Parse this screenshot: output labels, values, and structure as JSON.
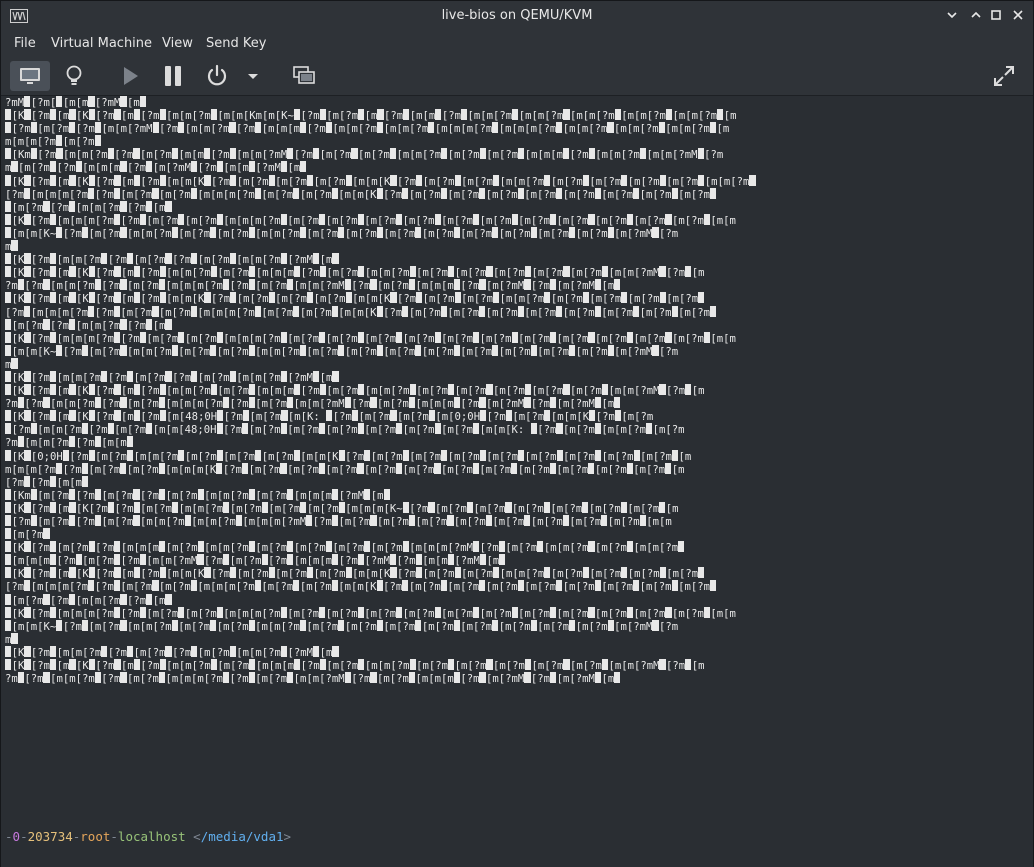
{
  "window": {
    "title": "live-bios on QEMU/KVM",
    "controls": [
      "minimize",
      "maximize",
      "restore",
      "close"
    ]
  },
  "menu": [
    "File",
    "Virtual Machine",
    "View",
    "Send Key"
  ],
  "toolbar": {
    "buttons": [
      {
        "name": "console-view",
        "icon": "monitor-icon"
      },
      {
        "name": "details-view",
        "icon": "lightbulb-icon"
      },
      {
        "name": "run",
        "icon": "play-icon"
      },
      {
        "name": "pause",
        "icon": "pause-icon"
      },
      {
        "name": "shutdown",
        "icon": "power-icon"
      },
      {
        "name": "shutdown-menu",
        "icon": "chevron-down-icon"
      },
      {
        "name": "snapshots",
        "icon": "screens-icon"
      },
      {
        "name": "fullscreen",
        "icon": "expand-icon"
      }
    ]
  },
  "terminal": {
    "lines": [
      "?mM▮[?m[▮[m[m▮[?mM▮[m▮",
      "▮[K▮[?m▮[m▮[K▮[?m▮[m▮[?m▮[m[m[?m▮[m[m[Km[m[K~▮[?m▮[m[?m▮[m▮[?m▮[m[m▮[?m▮[m[m[?m▮[m[m[?m▮[m[m[?m▮[m[m[?m▮[m[m[?m▮[m",
      "▮[?m▮[m[?m▮[?m▮[m[m[?mM▮[?m▮[m[m[?m▮[?m▮[m[m[m▮[?m▮[m[m[?m▮[m[m[?m▮[m[m[m[?m▮[m[m[m[?m▮[m[m[?m▮[m[m[?m▮[m[m[?m▮[m",
      "m[m[m[?m▮[m[?m▮",
      "▮[Km▮[?m▮[m[m[?m▮[?m▮[m[?m▮[m[m▮[?m▮[m[m[?mM▮[?m▮[m[?m▮[m[?m▮[m[m[?m▮[m[?m▮[m[?m▮[m[m[m▮[?m▮[m[m[?m▮[m[m[?mM▮[?m",
      "m▮[m[?m▮[?m▮[m[m[m▮[?m▮[m[?mM▮[?m▮[m[m▮[?mM▮[m▮",
      "▮[K▮[?m▮[m▮[K▮[?m▮[m▮[?m▮[m[m[K▮[?m▮[m[?m▮[m[?m▮[m[?m▮[m[m[K▮[?m▮[m[?m▮[m[?m▮[m[m[?m▮[m[?m▮[m[?m▮[m[?m▮[m[?m▮[m[m[?m▮",
      "[?m▮[m[m[m[?m▮[?m▮[m[?m▮[m[?m▮[m[m[m[?m▮[m[?m▮[m[?m▮[m[m[K▮[?m▮[m[?m▮[m[?m▮[m[?m▮[m[?m▮[m[?m▮[m[?m▮[m[?m▮[m[?m▮",
      "▮[m[?m▮[?m▮[m[m[?m▮[?m▮[m▮",
      "▮[K▮[?m▮[m[m[m[?m▮[?m▮[m[?m▮[m[?m▮[m[m[m[?m▮[m[?m▮[m[?m▮[m[?m▮[m[?m▮[m[?m▮[m[?m▮[m[?m▮[m[?m▮[m[?m▮[m[?m▮[m[?m▮[m[m",
      "▮[m[m[K~▮[?m▮[m[?m▮[m[m[?m▮[m[?m▮[m[?m▮[m[m[?m▮[m[?m▮[m[?m▮[m[?m▮[m[?m▮[m[?m▮[m[?m▮[m[?m▮[m[?m▮[m[?mM▮[?m",
      "m▮",
      "▮[K▮[?m▮[m[m[?m▮[?m▮[m[?m▮[?m▮[m[?m▮[m[m[?m▮[?mM▮[m▮",
      "▮[K▮[?m▮[m▮[K▮[?m▮[m▮[?m▮[m[m[?m▮[m[?m▮[m[m[m▮[?m▮[m[?m▮[m[m[?m▮[m[?m▮[m[?m▮[m[?m▮[m[?m▮[m[?m▮[m[m[?mM▮[?m▮[m",
      "?m▮[?m▮[m[m[?m▮[?m▮[m[?m▮[m[m[m[?m▮[?m▮[m[?m▮[m[m[?mM▮[?m▮[m[?m▮[m[m[m▮[?m▮[m[?mM▮[?m▮[m[?mM▮[m▮",
      "▮[K▮[?m▮[m▮[K▮[?m▮[m▮[?m▮[m[m[K▮[?m▮[m[?m▮[m[?m▮[m[?m▮[m[m[K▮[?m▮[m[?m▮[m[?m▮[m[m[?m▮[m[?m▮[m[?m▮[m[?m▮[m[?m▮",
      "[?m▮[m[m[m[?m▮[?m▮[m[?m▮[m[?m▮[m[m[m[?m▮[m[?m▮[m[?m▮[m[m[K▮[?m▮[m[?m▮[m[?m▮[m[?m▮[m[?m▮[m[?m▮[m[?m▮[m[?m▮[m[?m▮",
      "▮[m[?m▮[?m▮[m[m[?m▮[?m▮[m▮",
      "▮[K▮[?m▮[m[m[m[?m▮[?m▮[m[?m▮[m[?m▮[m[m[m[?m▮[m[?m▮[m[?m▮[m[?m▮[m[?m▮[m[?m▮[m[?m▮[m[?m▮[m[?m▮[m[?m▮[m[?m▮[m[?m▮[m[m",
      "▮[m[m[K~▮[?m▮[m[?m▮[m[m[?m▮[m[?m▮[m[?m▮[m[m[?m▮[m[?m▮[m[?m▮[m[?m▮[m[?m▮[m[?m▮[m[?m▮[m[?m▮[m[?m▮[m[?mM▮[?m",
      "m▮",
      "▮[K▮[?m▮[m[m[?m▮[?m▮[m[?m▮[?m▮[m[?m▮[m[m[?m▮[?mM▮[m▮",
      "▮[K▮[?m▮[m▮[K▮[?m▮[m▮[?m▮[m[m[?m▮[m[?m▮[m[m[m▮[?m▮[m[?m▮[m[m[?m▮[m[?m▮[m[?m▮[m[?m▮[m[?m▮[m[?m▮[m[m[?mM▮[?m▮[m",
      "?m▮[?m▮[m[m[?m▮[?m▮[m[?m▮[m[m[m[?m▮[?m▮[m[?m▮[m[m[?mM▮[?m▮[m[?m▮[m[m[m▮[?m▮[m[?mM▮[?m▮[m[?mM▮[m▮",
      "▮[K▮[?m▮[m▮[K▮[?m▮[m▮[?m▮[m[48;0H▮[?m▮[m[?m▮[m[K: ▮[?m▮[m[?m▮[m[?m▮[m[0;0H▮[?m▮[m[?m▮[m[m[K▮[?m▮[m[?m",
      "▮[?m▮[m[m[?m▮[?m▮[m[?m▮[m[m[48;0H▮[?m▮[m[?m▮[m[?m▮[m[?m▮[m[?m▮[m[?m▮[m[?m▮[m[m[K: ▮[?m▮[m[?m▮[m[m[?m▮[m[?m",
      "?m▮[m[m[?m▮[?m▮[m[m▮",
      "▮[K▮[0;0H▮[?m▮[m[?m▮[m[m[?m▮[m[?m▮[m[?m▮[m[?m▮[m[m[K▮[?m▮[m[?m▮[m[?m▮[m[?m▮[m[?m▮[m[?m▮[m[?m▮[m[?m▮[m[?m▮[m",
      "m[m[m[?m▮[?m▮[m[?m▮[m[?m▮[m[m[m[K▮[?m▮[m[?m▮[m[?m▮[m[?m▮[m[?m▮[m[?m▮[m[?m▮[m[?m▮[m[?m▮[m[?m▮[m[?m▮[m[?m▮[m",
      "[?m▮[?m▮[m[m▮",
      "▮[Km▮[m[?m▮[?m▮[m[?m▮[?m▮[m[?m▮[m[m[?m▮[m[?m▮[m[m[m▮[?mM▮[m▮",
      "▮[K▮[?m▮[m▮[K[?m▮[?m▮[m[?m▮[m[m[?m▮[m[?m▮[m[?m▮[m[?m▮[m[m[m[K~▮[?m▮[m[?m▮[m[?m▮[m[?m▮[m[?m▮[m[?m▮[m[?m▮[m",
      "▮[?m▮[m[?m▮[?m▮[m[?m▮[m[m[?m▮[m[m[?m▮[m[m[m[?mM▮[?m▮[m[?m▮[m[?m▮[m[?m▮[m[?m▮[m[?m▮[m[?m▮[m[?m▮[m[?m▮[m[m",
      "▮[m[?m▮",
      "▮[K▮[?m▮[m[?m▮[?m▮[m[m[m▮[m[?m▮[m[m[?m▮[m[?m▮[m[?m▮[m[?m▮[m[?m▮[m[m[m[?mM▮[?m▮[m[?m▮[m[m[?m▮[m[?m▮[m[m[?m▮",
      "▮[m[m[m▮[?m▮[m[?m▮[?m▮[m[m[?mM▮[?m▮[m[?m▮[?m▮[m[m[m▮[?m▮[?mM▮[?m▮[m[m▮[?mM▮[m▮",
      "▮[K▮[?m▮[m▮[K▮[?m▮[m▮[?m▮[m[m[K▮[?m▮[m[?m▮[m[?m▮[m[?m▮[m[m[K▮[?m▮[m[?m▮[m[?m▮[m[m[?m▮[m[?m▮[m[?m▮[m[?m▮[m[?m▮",
      "[?m▮[m[m[m[?m▮[?m▮[m[?m▮[m[?m▮[m[m[m[?m▮[m[?m▮[m[?m▮[m[m[K▮[?m▮[m[?m▮[m[?m▮[m[?m▮[m[?m▮[m[?m▮[m[?m▮[m[?m▮[m[?m▮",
      "▮[m[?m▮[?m▮[m[m[?m▮[?m▮[m▮",
      "▮[K▮[?m▮[m[m[m[?m▮[?m▮[m[?m▮[m[?m▮[m[m[m[?m▮[m[?m▮[m[?m▮[m[?m▮[m[?m▮[m[?m▮[m[?m▮[m[?m▮[m[?m▮[m[?m▮[m[?m▮[m[?m▮[m[m",
      "▮[m[m[K~▮[?m▮[m[?m▮[m[m[?m▮[m[?m▮[m[?m▮[m[m[?m▮[m[?m▮[m[?m▮[m[?m▮[m[?m▮[m[?m▮[m[?m▮[m[?m▮[m[?m▮[m[?mM▮[?m",
      "m▮",
      "▮[K▮[?m▮[m[m[?m▮[?m▮[m[?m▮[?m▮[m[?m▮[m[m[?m▮[?mM▮[m▮",
      "▮[K▮[?m▮[m▮[K▮[?m▮[m▮[?m▮[m[m[?m▮[m[?m▮[m[m[m▮[?m▮[m[?m▮[m[m[?m▮[m[?m▮[m[?m▮[m[?m▮[m[?m▮[m[?m▮[m[m[?mM▮[?m▮[m",
      "?m▮[?m▮[m[m[?m▮[?m▮[m[?m▮[m[m[m[?m▮[?m▮[m[?m▮[m[m[?mM▮[?m▮[m[?m▮[m[m[m▮[?m▮[m[?mM▮[?m▮[m[?mM▮[m▮"
    ]
  },
  "prompt": {
    "num1": "0",
    "num2": "203734",
    "user": "root",
    "host": "localhost",
    "path": "/media/vda1"
  }
}
